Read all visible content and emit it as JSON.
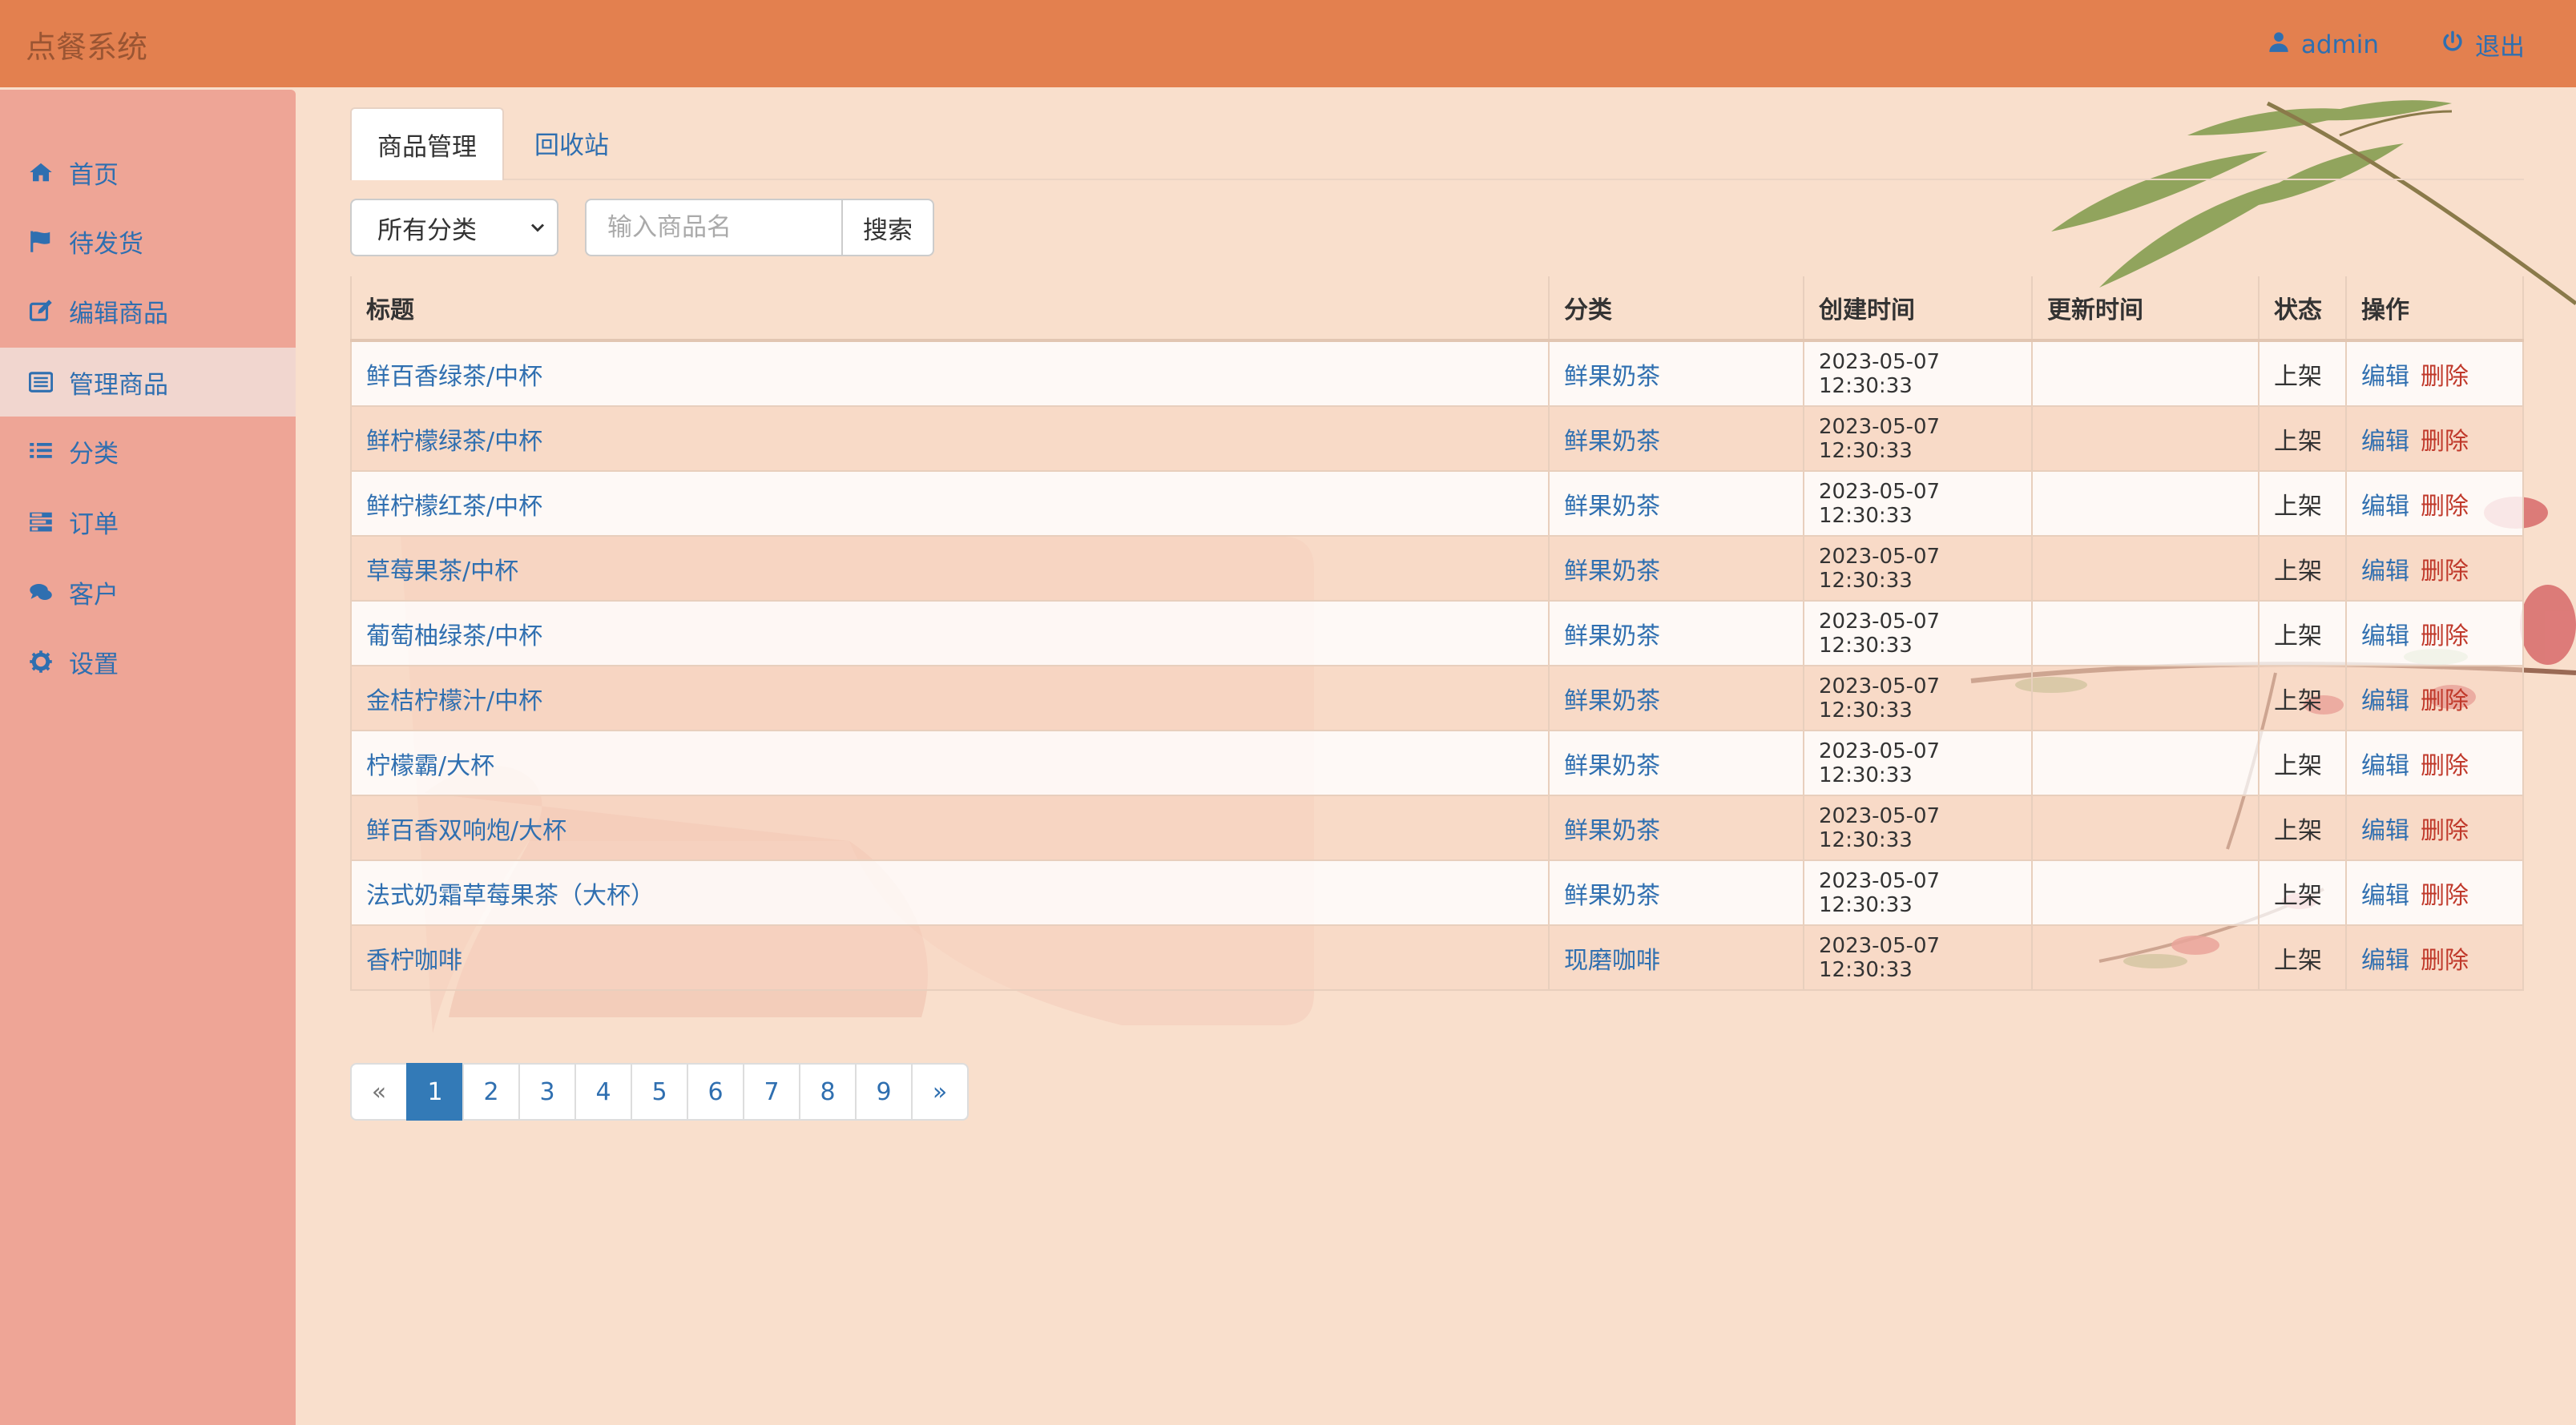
{
  "app": {
    "title": "点餐系统"
  },
  "navbar": {
    "user": "admin",
    "logout": "退出"
  },
  "sidebar": {
    "items": [
      {
        "label": "首页",
        "icon": "home-icon"
      },
      {
        "label": "待发货",
        "icon": "flag-icon"
      },
      {
        "label": "编辑商品",
        "icon": "edit-icon"
      },
      {
        "label": "管理商品",
        "icon": "list-alt-icon",
        "active": true
      },
      {
        "label": "分类",
        "icon": "list-icon"
      },
      {
        "label": "订单",
        "icon": "tasks-icon"
      },
      {
        "label": "客户",
        "icon": "comments-icon"
      },
      {
        "label": "设置",
        "icon": "gear-icon"
      }
    ]
  },
  "tabs": [
    {
      "label": "商品管理",
      "active": true
    },
    {
      "label": "回收站",
      "active": false
    }
  ],
  "filter": {
    "category_selected": "所有分类",
    "search_placeholder": "输入商品名",
    "search_button": "搜索"
  },
  "table": {
    "headers": {
      "title": "标题",
      "category": "分类",
      "created": "创建时间",
      "updated": "更新时间",
      "status": "状态",
      "ops": "操作"
    },
    "rows": [
      {
        "title": "鲜百香绿茶/中杯",
        "category": "鲜果奶茶",
        "created": "2023-05-07 12:30:33",
        "updated": "",
        "status": "上架",
        "edit": "编辑",
        "delete": "删除"
      },
      {
        "title": "鲜柠檬绿茶/中杯",
        "category": "鲜果奶茶",
        "created": "2023-05-07 12:30:33",
        "updated": "",
        "status": "上架",
        "edit": "编辑",
        "delete": "删除"
      },
      {
        "title": "鲜柠檬红茶/中杯",
        "category": "鲜果奶茶",
        "created": "2023-05-07 12:30:33",
        "updated": "",
        "status": "上架",
        "edit": "编辑",
        "delete": "删除"
      },
      {
        "title": "草莓果茶/中杯",
        "category": "鲜果奶茶",
        "created": "2023-05-07 12:30:33",
        "updated": "",
        "status": "上架",
        "edit": "编辑",
        "delete": "删除"
      },
      {
        "title": "葡萄柚绿茶/中杯",
        "category": "鲜果奶茶",
        "created": "2023-05-07 12:30:33",
        "updated": "",
        "status": "上架",
        "edit": "编辑",
        "delete": "删除"
      },
      {
        "title": "金桔柠檬汁/中杯",
        "category": "鲜果奶茶",
        "created": "2023-05-07 12:30:33",
        "updated": "",
        "status": "上架",
        "edit": "编辑",
        "delete": "删除"
      },
      {
        "title": "柠檬霸/大杯",
        "category": "鲜果奶茶",
        "created": "2023-05-07 12:30:33",
        "updated": "",
        "status": "上架",
        "edit": "编辑",
        "delete": "删除"
      },
      {
        "title": "鲜百香双响炮/大杯",
        "category": "鲜果奶茶",
        "created": "2023-05-07 12:30:33",
        "updated": "",
        "status": "上架",
        "edit": "编辑",
        "delete": "删除"
      },
      {
        "title": "法式奶霜草莓果茶（大杯）",
        "category": "鲜果奶茶",
        "created": "2023-05-07 12:30:33",
        "updated": "",
        "status": "上架",
        "edit": "编辑",
        "delete": "删除"
      },
      {
        "title": "香柠咖啡",
        "category": "现磨咖啡",
        "created": "2023-05-07 12:30:33",
        "updated": "",
        "status": "上架",
        "edit": "编辑",
        "delete": "删除"
      }
    ]
  },
  "pagination": {
    "prev": "«",
    "pages": [
      "1",
      "2",
      "3",
      "4",
      "5",
      "6",
      "7",
      "8",
      "9"
    ],
    "current": "1",
    "next": "»"
  },
  "colors": {
    "navbar": "#e3804f",
    "sidebar": "#eea596",
    "background": "#f9dfcc",
    "link": "#2f6fb0",
    "danger": "#c0392b",
    "active_page": "#337ab7"
  }
}
